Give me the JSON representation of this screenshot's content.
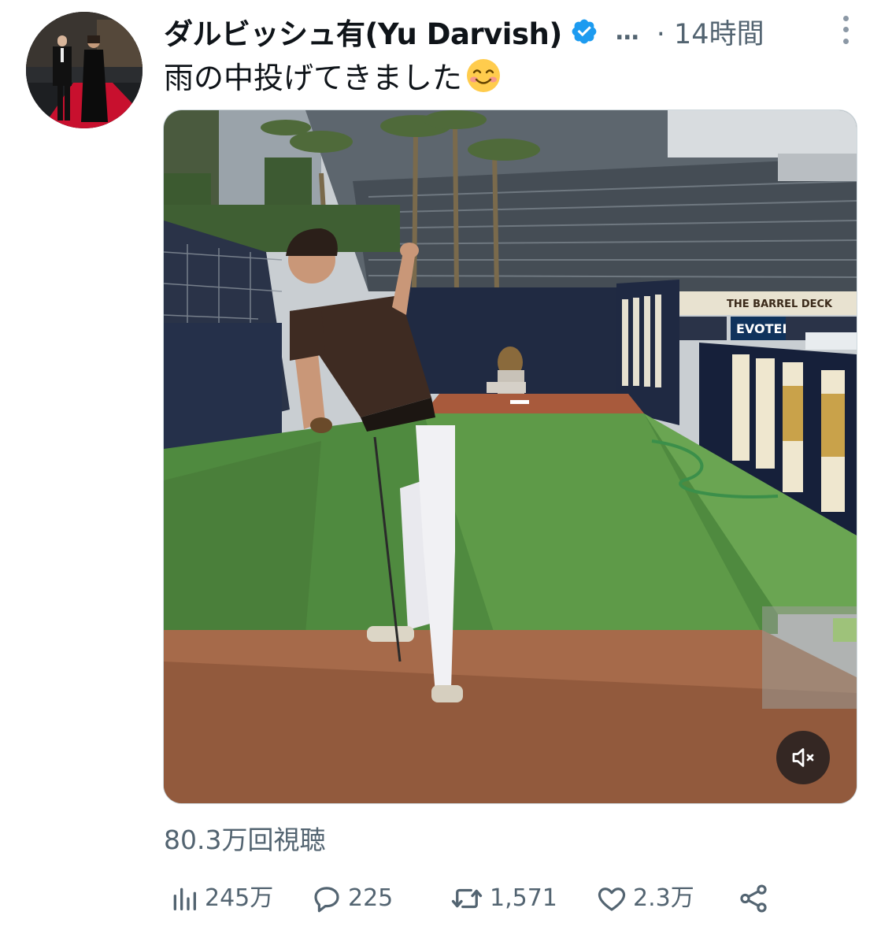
{
  "author": {
    "display_name": "ダルビッシュ有(Yu Darvish)",
    "ellipsis": "…",
    "separator": "·",
    "time": "14時間",
    "avatar_icon": "avatar-photo-icon",
    "verified_icon": "verified-badge-icon",
    "verified_color": "#1d9bf0"
  },
  "tweet": {
    "text": "雨の中投げてきました",
    "emoji": "smiling-face-with-smiling-eyes-icon"
  },
  "media": {
    "type": "video",
    "sign_barrel_deck": "THE BARREL DECK",
    "sign_evotek": "EVOTEK",
    "mute_icon": "volume-muted-icon"
  },
  "view_count": "80.3万回視聴",
  "actions": {
    "views": {
      "icon": "analytics-bar-icon",
      "count": "245万"
    },
    "replies": {
      "icon": "reply-bubble-icon",
      "count": "225"
    },
    "reposts": {
      "icon": "repost-arrows-icon",
      "count": "1,571"
    },
    "likes": {
      "icon": "heart-icon",
      "count": "2.3万"
    },
    "share": {
      "icon": "share-icon"
    }
  },
  "colors": {
    "text_primary": "#0f1419",
    "text_secondary": "#536471",
    "accent": "#1d9bf0"
  }
}
